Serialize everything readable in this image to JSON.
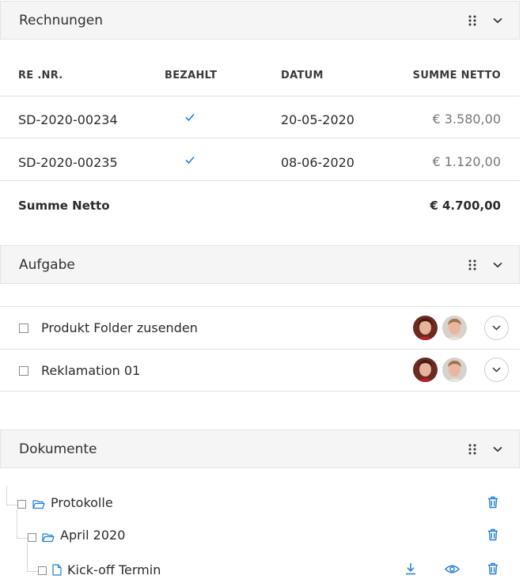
{
  "rechnungen": {
    "title": "Rechnungen",
    "columns": [
      "RE .NR.",
      "BEZAHLT",
      "DATUM",
      "SUMME NETTO"
    ],
    "rows": [
      {
        "nr": "SD-2020-00234",
        "paid": true,
        "date": "20-05-2020",
        "sum": "€ 3.580,00"
      },
      {
        "nr": "SD-2020-00235",
        "paid": true,
        "date": "08-06-2020",
        "sum": "€ 1.120,00"
      }
    ],
    "total_label": "Summe Netto",
    "total_value": "€ 4.700,00"
  },
  "aufgabe": {
    "title": "Aufgabe",
    "items": [
      {
        "label": "Produkt Folder zusenden"
      },
      {
        "label": "Reklamation 01"
      }
    ]
  },
  "dokumente": {
    "title": "Dokumente",
    "tree": [
      {
        "label": "Protokolle",
        "type": "folder"
      },
      {
        "label": "April 2020",
        "type": "folder"
      },
      {
        "label": "Kick-off Termin",
        "type": "file"
      }
    ]
  },
  "icons": {
    "drag": "drag-handle-icon",
    "collapse": "chevron-down-icon",
    "check": "checkmark-icon",
    "folder": "folder-open-icon",
    "file": "file-icon",
    "delete": "trash-icon",
    "download": "download-icon",
    "view": "eye-icon"
  },
  "colors": {
    "accent": "#1f7fd6",
    "header_bg": "#f5f5f5",
    "border": "#e1e1e1"
  }
}
